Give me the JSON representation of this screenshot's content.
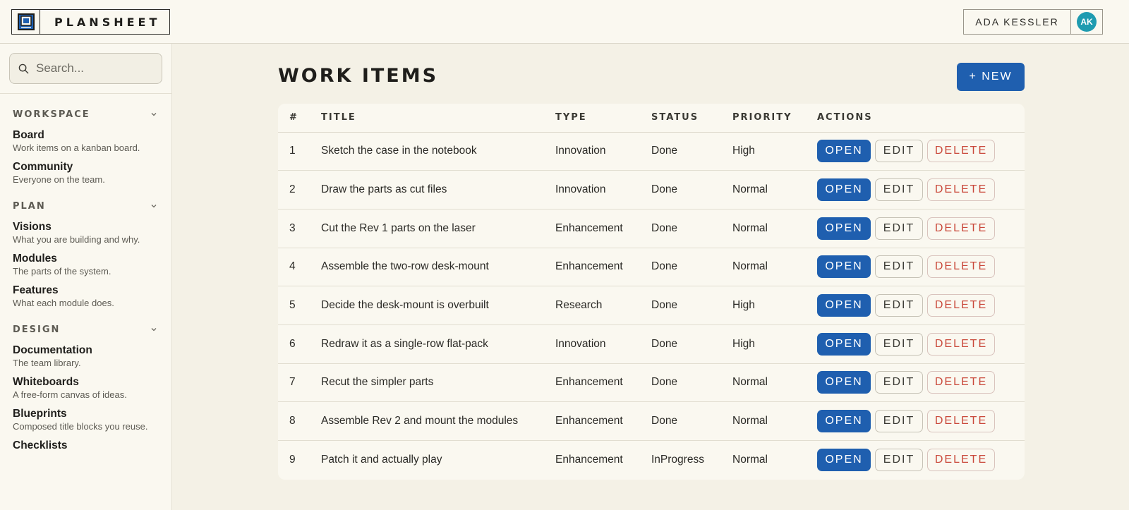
{
  "app": {
    "name": "PLANSHEET"
  },
  "user": {
    "name": "ADA KESSLER",
    "initials": "AK"
  },
  "search": {
    "placeholder": "Search..."
  },
  "sidebar": {
    "sections": [
      {
        "title": "WORKSPACE",
        "items": [
          {
            "label": "Board",
            "desc": "Work items on a kanban board."
          },
          {
            "label": "Community",
            "desc": "Everyone on the team."
          }
        ]
      },
      {
        "title": "PLAN",
        "items": [
          {
            "label": "Visions",
            "desc": "What you are building and why."
          },
          {
            "label": "Modules",
            "desc": "The parts of the system."
          },
          {
            "label": "Features",
            "desc": "What each module does."
          }
        ]
      },
      {
        "title": "DESIGN",
        "items": [
          {
            "label": "Documentation",
            "desc": "The team library."
          },
          {
            "label": "Whiteboards",
            "desc": "A free-form canvas of ideas."
          },
          {
            "label": "Blueprints",
            "desc": "Composed title blocks you reuse."
          },
          {
            "label": "Checklists",
            "desc": ""
          }
        ]
      }
    ]
  },
  "main": {
    "title": "WORK ITEMS",
    "new_label": "+ NEW",
    "columns": [
      "#",
      "TITLE",
      "TYPE",
      "STATUS",
      "PRIORITY",
      "ACTIONS"
    ],
    "actions": {
      "open": "OPEN",
      "edit": "EDIT",
      "delete": "DELETE"
    },
    "rows": [
      {
        "num": "1",
        "title": "Sketch the case in the notebook",
        "type": "Innovation",
        "status": "Done",
        "priority": "High"
      },
      {
        "num": "2",
        "title": "Draw the parts as cut files",
        "type": "Innovation",
        "status": "Done",
        "priority": "Normal"
      },
      {
        "num": "3",
        "title": "Cut the Rev 1 parts on the laser",
        "type": "Enhancement",
        "status": "Done",
        "priority": "Normal"
      },
      {
        "num": "4",
        "title": "Assemble the two-row desk-mount",
        "type": "Enhancement",
        "status": "Done",
        "priority": "Normal"
      },
      {
        "num": "5",
        "title": "Decide the desk-mount is overbuilt",
        "type": "Research",
        "status": "Done",
        "priority": "High"
      },
      {
        "num": "6",
        "title": "Redraw it as a single-row flat-pack",
        "type": "Innovation",
        "status": "Done",
        "priority": "High"
      },
      {
        "num": "7",
        "title": "Recut the simpler parts",
        "type": "Enhancement",
        "status": "Done",
        "priority": "Normal"
      },
      {
        "num": "8",
        "title": "Assemble Rev 2 and mount the modules",
        "type": "Enhancement",
        "status": "Done",
        "priority": "Normal"
      },
      {
        "num": "9",
        "title": "Patch it and actually play",
        "type": "Enhancement",
        "status": "InProgress",
        "priority": "Normal"
      }
    ]
  },
  "colors": {
    "accent": "#1f5faf",
    "danger": "#c9483a",
    "avatar": "#1f9bb0",
    "background": "#f4f1e6"
  }
}
